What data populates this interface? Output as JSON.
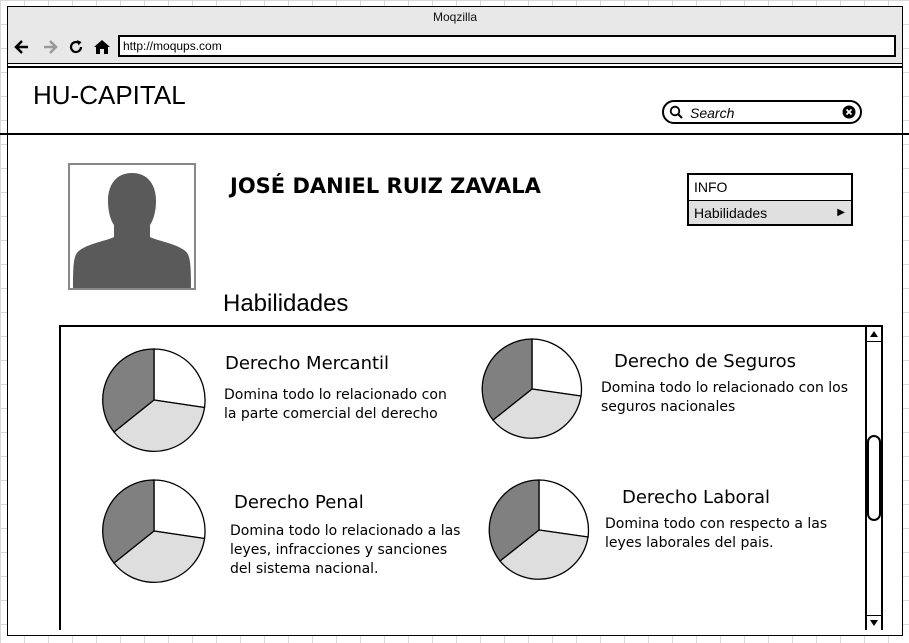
{
  "window": {
    "title": "Moqzilla"
  },
  "toolbar": {
    "back_icon": "arrow-left-icon",
    "forward_icon": "arrow-right-icon",
    "reload_icon": "reload-icon",
    "home_icon": "home-icon",
    "url": "http://moqups.com"
  },
  "header": {
    "brand": "HU-CAPITAL",
    "search_placeholder": "Search"
  },
  "profile": {
    "name": "JOSÉ DANIEL RUIZ ZAVALA"
  },
  "menu": {
    "items": [
      {
        "label": "INFO"
      },
      {
        "label": "Habilidades"
      }
    ]
  },
  "section": {
    "title": "Habilidades"
  },
  "skills": [
    {
      "title": "Derecho Mercantil",
      "desc_lines": [
        "Domina todo lo relacionado con",
        "la parte comercial del derecho"
      ]
    },
    {
      "title": "Derecho de Seguros",
      "desc_lines": [
        "Domina todo lo relacionado con los",
        "seguros nacionales"
      ]
    },
    {
      "title": "Derecho Penal",
      "desc_lines": [
        "Domina todo lo relacionado a las",
        "leyes, infracciones y sanciones",
        "del sistema nacional."
      ]
    },
    {
      "title": "Derecho Laboral",
      "desc_lines": [
        "Domina todo con respecto a las",
        "leyes laborales del pais."
      ]
    }
  ],
  "colors": {
    "pie_dark": "#808080",
    "pie_light": "#dedede",
    "pie_white": "#ffffff",
    "avatar": "#5a5a5a"
  }
}
